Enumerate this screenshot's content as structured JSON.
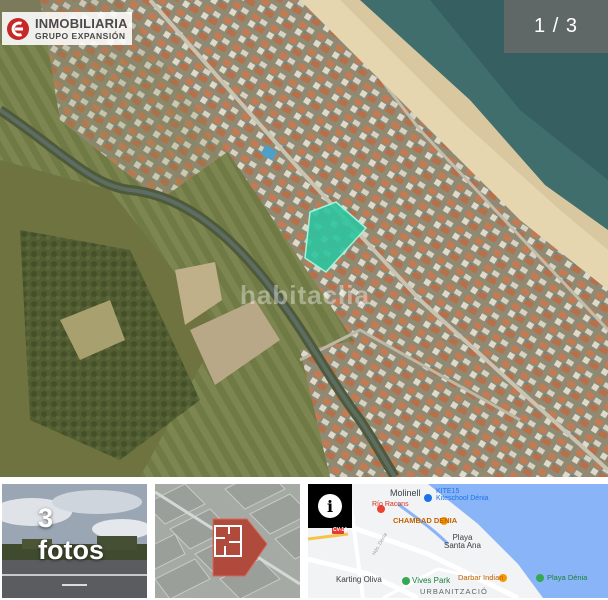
{
  "logo": {
    "line1": "INMOBILIARIA",
    "line2": "GRUPO EXPANSIÓN",
    "brand_color": "#c62828"
  },
  "gallery": {
    "counter": "1 / 3",
    "watermark": "habitaclia"
  },
  "thumbnails": {
    "photos": {
      "count": "3",
      "label": "fotos"
    },
    "plan": {
      "icon": "floorplan-icon"
    },
    "map": {
      "info_icon": "info-icon",
      "places": {
        "molinell": "Molinell",
        "kite_line1": "KITE15",
        "kite_line2": "Kiteschool Dénia",
        "rio_racons": "Río Racons",
        "chambad": "CHAMBAD DENIA",
        "playa_line1": "Playa",
        "playa_line2": "Santa Ana",
        "karting": "Karting Oliva",
        "vives": "Vives Park",
        "darbar": "Darbar Indian",
        "playa_denia": "Playa Dénia",
        "urbanitzacio": "URBANITZACIÓ",
        "road_left": "CV-14",
        "road_right": "Hdo. Dénia"
      }
    }
  }
}
